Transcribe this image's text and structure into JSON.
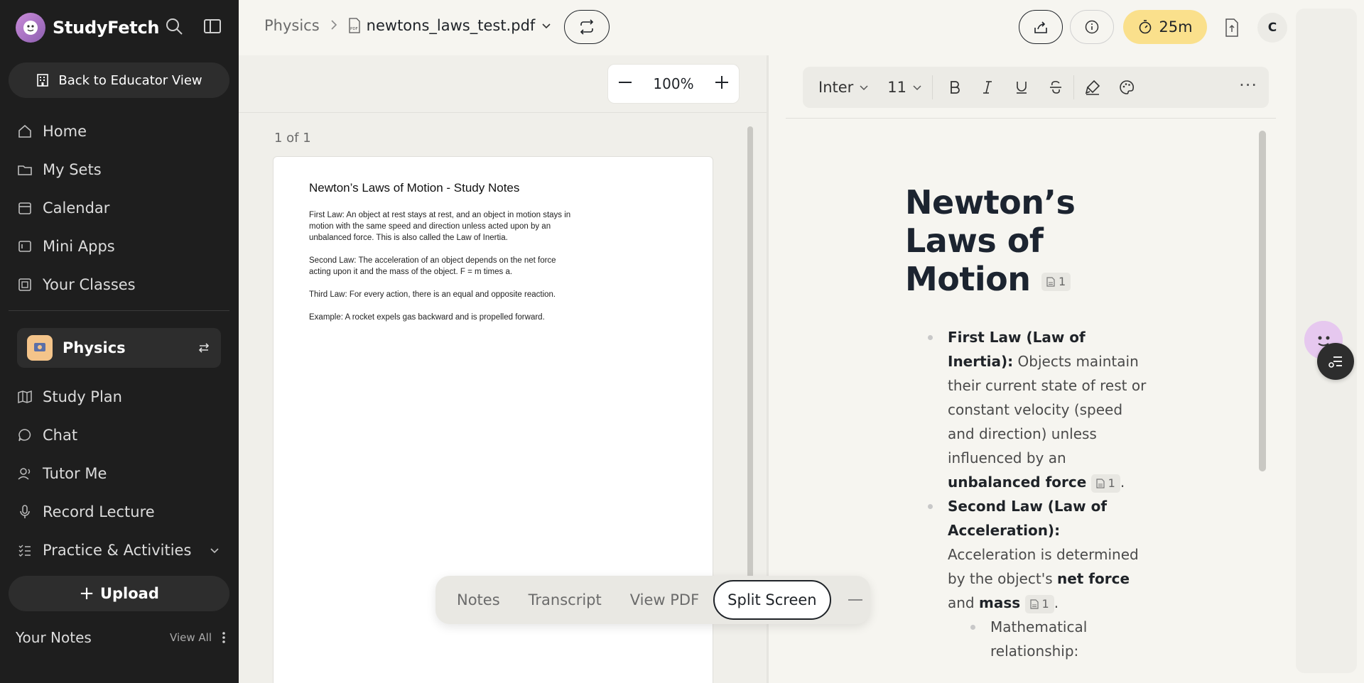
{
  "brand": {
    "name": "StudyFetch"
  },
  "sidebar": {
    "back_label": "Back to Educator View",
    "nav_top": [
      {
        "label": "Home",
        "icon": "home-icon"
      },
      {
        "label": "My Sets",
        "icon": "folder-icon"
      },
      {
        "label": "Calendar",
        "icon": "calendar-icon"
      },
      {
        "label": "Mini Apps",
        "icon": "app-window-icon"
      },
      {
        "label": "Your Classes",
        "icon": "classes-icon"
      }
    ],
    "class_name": "Physics",
    "nav_class": [
      {
        "label": "Study Plan",
        "icon": "map-icon"
      },
      {
        "label": "Chat",
        "icon": "chat-icon"
      },
      {
        "label": "Tutor Me",
        "icon": "tutor-icon"
      },
      {
        "label": "Record Lecture",
        "icon": "microphone-icon"
      },
      {
        "label": "Practice & Activities",
        "icon": "checklist-icon"
      }
    ],
    "upload_label": "Upload",
    "your_notes": "Your Notes",
    "view_all": "View All"
  },
  "header": {
    "course": "Physics",
    "file_name": "newtons_laws_test.pdf",
    "timer": "25m",
    "avatar_initial": "C"
  },
  "pdf": {
    "zoom": "100%",
    "page_count": "1 of 1",
    "title": "Newton’s Laws of Motion - Study Notes",
    "paragraphs": [
      "First Law: An object at rest stays at rest, and an object in motion stays in motion with the same speed and direction unless acted upon by an unbalanced force. This is also called the Law of Inertia.",
      "Second Law: The acceleration of an object depends on the net force acting upon it and the mass of the object. F = m times a.",
      "Third Law: For every action, there is an equal and opposite reaction.",
      "Example: A rocket expels gas backward and is propelled forward."
    ]
  },
  "editor": {
    "font": "Inter",
    "size": "11",
    "title": "Newton’s Laws of Motion",
    "cite": "1",
    "items": [
      {
        "heading": "First Law (Law of Inertia):",
        "text": "Objects maintain their current state of rest or constant velocity (speed and direction) unless influenced by an",
        "bold_tail": "unbalanced force",
        "end": "."
      },
      {
        "heading": "Second Law (Law of Acceleration):",
        "text": "Acceleration is determined by the object's",
        "bold_mid": "net force",
        "and": "and",
        "bold_tail": "mass",
        "end": ".",
        "sub": "Mathematical relationship:"
      }
    ]
  },
  "view_switch": {
    "tabs": [
      "Notes",
      "Transcript",
      "View PDF",
      "Split Screen"
    ],
    "active": "Split Screen"
  },
  "colors": {
    "sidebar_bg": "#1e1e1e",
    "timer_bg": "#fae08c",
    "page_bg": "#f6f5f0"
  }
}
